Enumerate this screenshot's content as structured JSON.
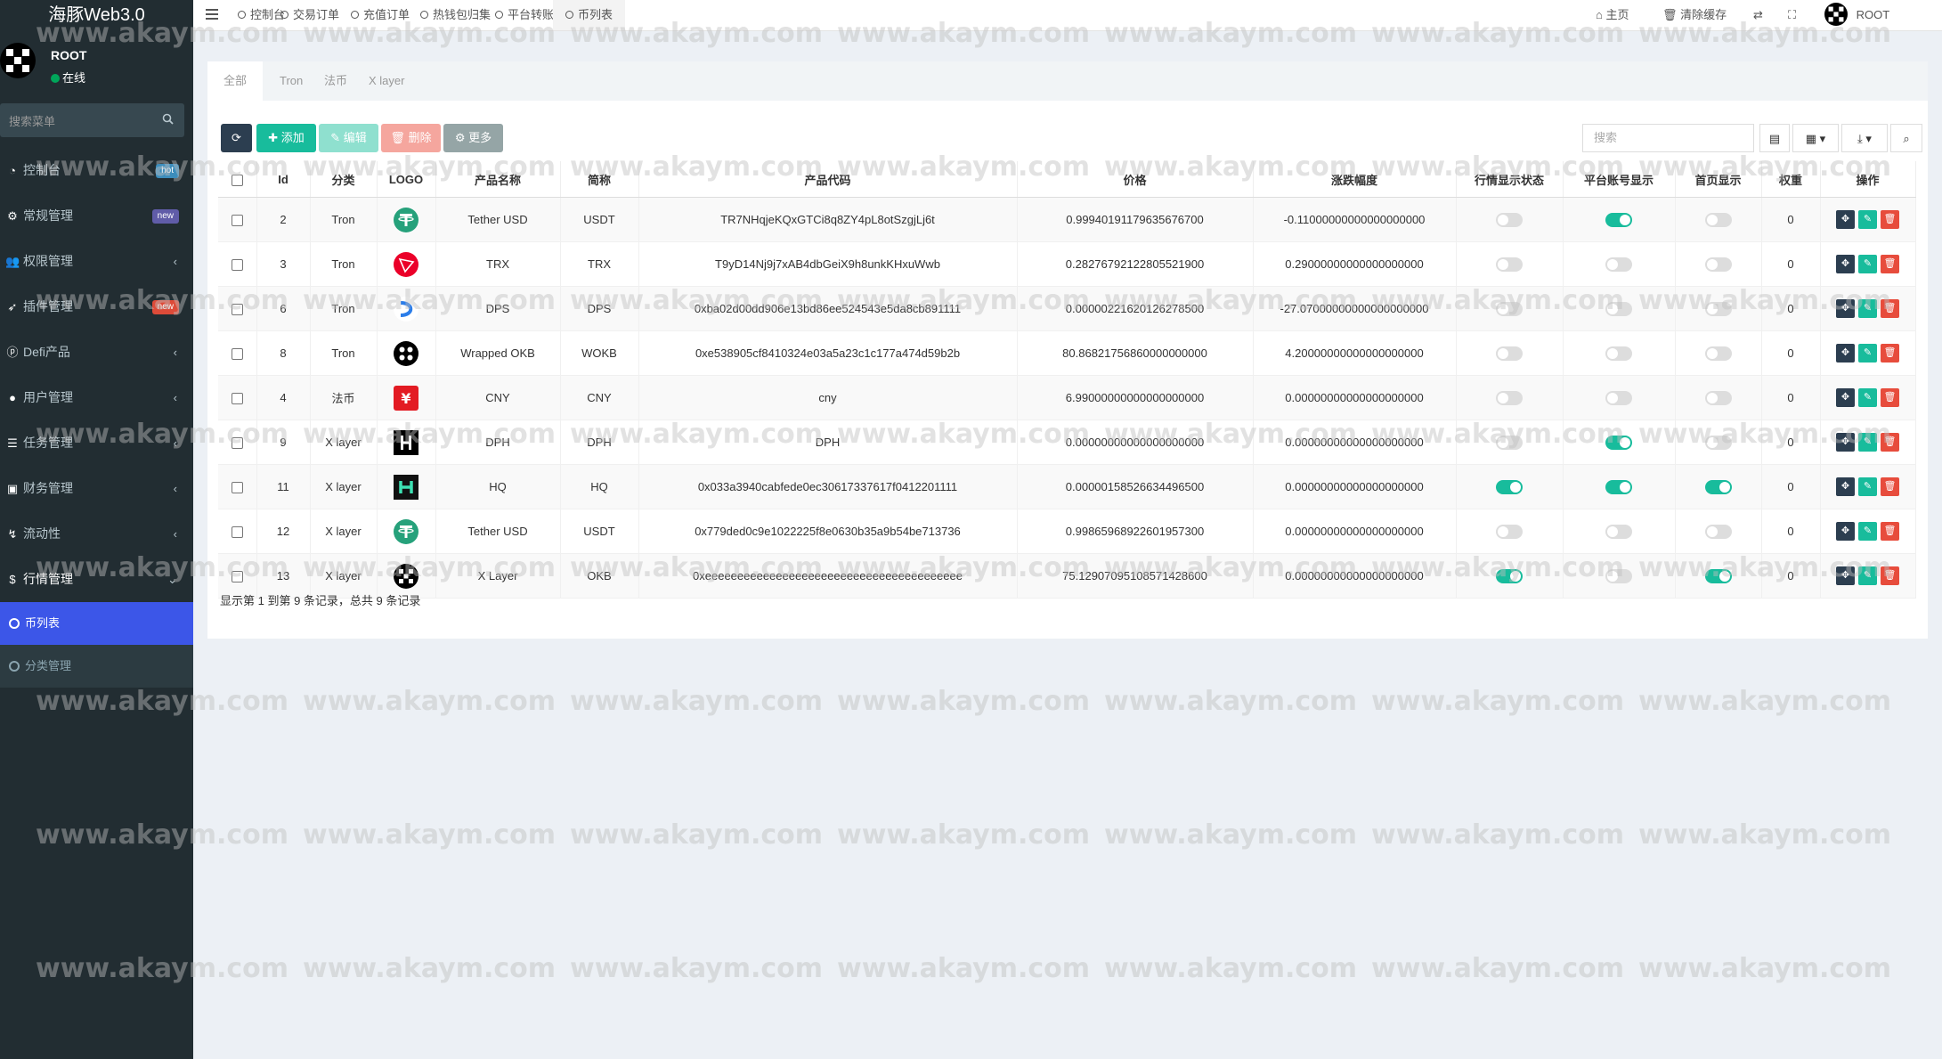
{
  "brand": "海豚Web3.0",
  "user": {
    "name": "ROOT",
    "status": "在线"
  },
  "sidebar_search": {
    "placeholder": "搜索菜单"
  },
  "menu": [
    {
      "label": "控制台",
      "icon": "dashboard-icon",
      "badge": "hot",
      "badge_color": "#3c8dbc"
    },
    {
      "label": "常规管理",
      "icon": "cogs-icon",
      "badge": "new",
      "badge_color": "#605ca8"
    },
    {
      "label": "权限管理",
      "icon": "group-icon",
      "chevron": true
    },
    {
      "label": "插件管理",
      "icon": "rocket-icon",
      "badge": "new",
      "badge_color": "#dd4b39"
    },
    {
      "label": "Defi产品",
      "icon": "coin-icon",
      "chevron": true
    },
    {
      "label": "用户管理",
      "icon": "user-icon",
      "chevron": true
    },
    {
      "label": "任务管理",
      "icon": "list-icon",
      "chevron": true
    },
    {
      "label": "财务管理",
      "icon": "money-icon",
      "chevron": true
    },
    {
      "label": "流动性",
      "icon": "chart-icon",
      "chevron": true
    },
    {
      "label": "行情管理",
      "icon": "dollar-icon",
      "chevron": true,
      "open": true
    }
  ],
  "submenu": [
    {
      "label": "币列表",
      "active": true
    },
    {
      "label": "分类管理",
      "active": false
    }
  ],
  "topnav": {
    "items": [
      "控制台",
      "交易订单",
      "充值订单",
      "热钱包归集",
      "平台转账",
      "币列表"
    ],
    "home": "主页",
    "clear_cache": "清除缓存",
    "user": "ROOT"
  },
  "tabs": [
    "全部",
    "Tron",
    "法币",
    "X layer"
  ],
  "toolbar": {
    "add": "添加",
    "edit": "编辑",
    "delete": "删除",
    "more": "更多",
    "search_placeholder": "搜索"
  },
  "columns": [
    "Id",
    "分类",
    "LOGO",
    "产品名称",
    "简称",
    "产品代码",
    "价格",
    "涨跌幅度",
    "行情显示状态",
    "平台账号显示",
    "首页显示",
    "权重",
    "操作"
  ],
  "rows": [
    {
      "id": "2",
      "category": "Tron",
      "logo": "tether-logo",
      "name": "Tether USD",
      "symbol": "USDT",
      "code": "TR7NHqjeKQxGTCi8q8ZY4pL8otSzgjLj6t",
      "price": "0.99940191179635676700",
      "change": "-0.11000000000000000000",
      "market": false,
      "platform": true,
      "home": false,
      "weight": "0"
    },
    {
      "id": "3",
      "category": "Tron",
      "logo": "tron-logo",
      "name": "TRX",
      "symbol": "TRX",
      "code": "T9yD14Nj9j7xAB4dbGeiX9h8unkKHxuWwb",
      "price": "0.28276792122805521900",
      "change": "0.29000000000000000000",
      "market": false,
      "platform": false,
      "home": false,
      "weight": "0"
    },
    {
      "id": "6",
      "category": "Tron",
      "logo": "dps-logo",
      "name": "DPS",
      "symbol": "DPS",
      "code": "0xba02d00dd906e13bd86ee524543e5da8cb891111",
      "price": "0.00000221620126278500",
      "change": "-27.07000000000000000000",
      "market": false,
      "platform": false,
      "home": false,
      "weight": "0"
    },
    {
      "id": "8",
      "category": "Tron",
      "logo": "okb-logo",
      "name": "Wrapped OKB",
      "symbol": "WOKB",
      "code": "0xe538905cf8410324e03a5a23c1c177a474d59b2b",
      "price": "80.86821756860000000000",
      "change": "4.20000000000000000000",
      "market": false,
      "platform": false,
      "home": false,
      "weight": "0"
    },
    {
      "id": "4",
      "category": "法币",
      "logo": "yen-logo",
      "name": "CNY",
      "symbol": "CNY",
      "code": "cny",
      "price": "6.99000000000000000000",
      "change": "0.00000000000000000000",
      "market": false,
      "platform": false,
      "home": false,
      "weight": "0"
    },
    {
      "id": "9",
      "category": "X layer",
      "logo": "dph-logo",
      "name": "DPH",
      "symbol": "DPH",
      "code": "DPH",
      "price": "0.00000000000000000000",
      "change": "0.00000000000000000000",
      "market": false,
      "platform": true,
      "home": false,
      "weight": "0"
    },
    {
      "id": "11",
      "category": "X layer",
      "logo": "hq-logo",
      "name": "HQ",
      "symbol": "HQ",
      "code": "0x033a3940cabfede0ec30617337617f0412201111",
      "price": "0.00000158526634496500",
      "change": "0.00000000000000000000",
      "market": true,
      "platform": true,
      "home": true,
      "weight": "0"
    },
    {
      "id": "12",
      "category": "X layer",
      "logo": "tether-logo",
      "name": "Tether USD",
      "symbol": "USDT",
      "code": "0x779ded0c9e1022225f8e0630b35a9b54be713736",
      "price": "0.99865968922601957300",
      "change": "0.00000000000000000000",
      "market": false,
      "platform": false,
      "home": false,
      "weight": "0"
    },
    {
      "id": "13",
      "category": "X layer",
      "logo": "xlayer-logo",
      "name": "X Layer",
      "symbol": "OKB",
      "code": "0xeeeeeeeeeeeeeeeeeeeeeeeeeeeeeeeeeeeeeeee",
      "price": "75.12907095108571428600",
      "change": "0.00000000000000000000",
      "market": true,
      "platform": false,
      "home": true,
      "weight": "0"
    }
  ],
  "pagination_info": "显示第 1 到第 9 条记录，总共 9 条记录",
  "watermark": "www.akaym.com",
  "colors": {
    "sidebar": "#222d32",
    "active": "#3c56e8",
    "toggle_on": "#18bc9c",
    "add": "#18bc9c",
    "edit": "#18bc9c",
    "delete": "#e74c3c",
    "more": "#95a5a6",
    "refresh": "#2c3e50"
  }
}
